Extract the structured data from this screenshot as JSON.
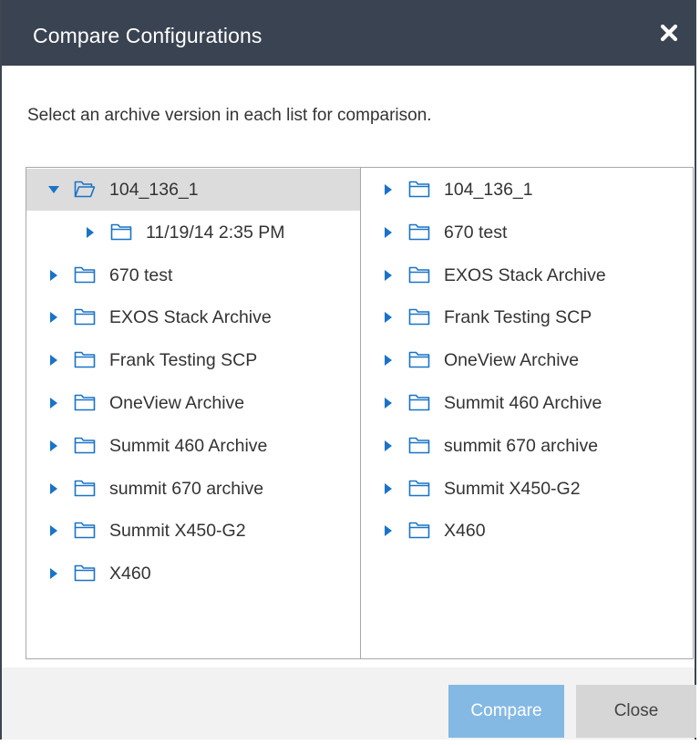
{
  "dialog": {
    "title": "Compare Configurations",
    "instructions": "Select an archive version in each list for comparison."
  },
  "left_tree": [
    {
      "label": "104_136_1",
      "expanded": true,
      "selected": true,
      "depth": 0
    },
    {
      "label": "11/19/14 2:35 PM",
      "expanded": false,
      "selected": false,
      "depth": 1
    },
    {
      "label": "670 test",
      "expanded": false,
      "selected": false,
      "depth": 0
    },
    {
      "label": "EXOS Stack Archive",
      "expanded": false,
      "selected": false,
      "depth": 0
    },
    {
      "label": "Frank Testing SCP",
      "expanded": false,
      "selected": false,
      "depth": 0
    },
    {
      "label": "OneView Archive",
      "expanded": false,
      "selected": false,
      "depth": 0
    },
    {
      "label": "Summit 460 Archive",
      "expanded": false,
      "selected": false,
      "depth": 0
    },
    {
      "label": "summit 670 archive",
      "expanded": false,
      "selected": false,
      "depth": 0
    },
    {
      "label": "Summit X450-G2",
      "expanded": false,
      "selected": false,
      "depth": 0
    },
    {
      "label": "X460",
      "expanded": false,
      "selected": false,
      "depth": 0
    }
  ],
  "right_tree": [
    {
      "label": "104_136_1",
      "expanded": false
    },
    {
      "label": "670 test",
      "expanded": false
    },
    {
      "label": "EXOS Stack Archive",
      "expanded": false
    },
    {
      "label": "Frank Testing SCP",
      "expanded": false
    },
    {
      "label": "OneView Archive",
      "expanded": false
    },
    {
      "label": "Summit 460 Archive",
      "expanded": false
    },
    {
      "label": "summit 670 archive",
      "expanded": false
    },
    {
      "label": "Summit X450-G2",
      "expanded": false
    },
    {
      "label": "X460",
      "expanded": false
    }
  ],
  "buttons": {
    "compare": "Compare",
    "close": "Close"
  },
  "icons": {
    "close": "close-icon",
    "folder": "folder-icon",
    "folder_open": "folder-open-icon",
    "expander": "triangle-expander-icon"
  },
  "colors": {
    "titlebar": "#3a4352",
    "accent": "#1a73c7",
    "compare_button": "#84b9e4",
    "close_button": "#d6d6d6",
    "selected_row": "#dcdcdc"
  }
}
